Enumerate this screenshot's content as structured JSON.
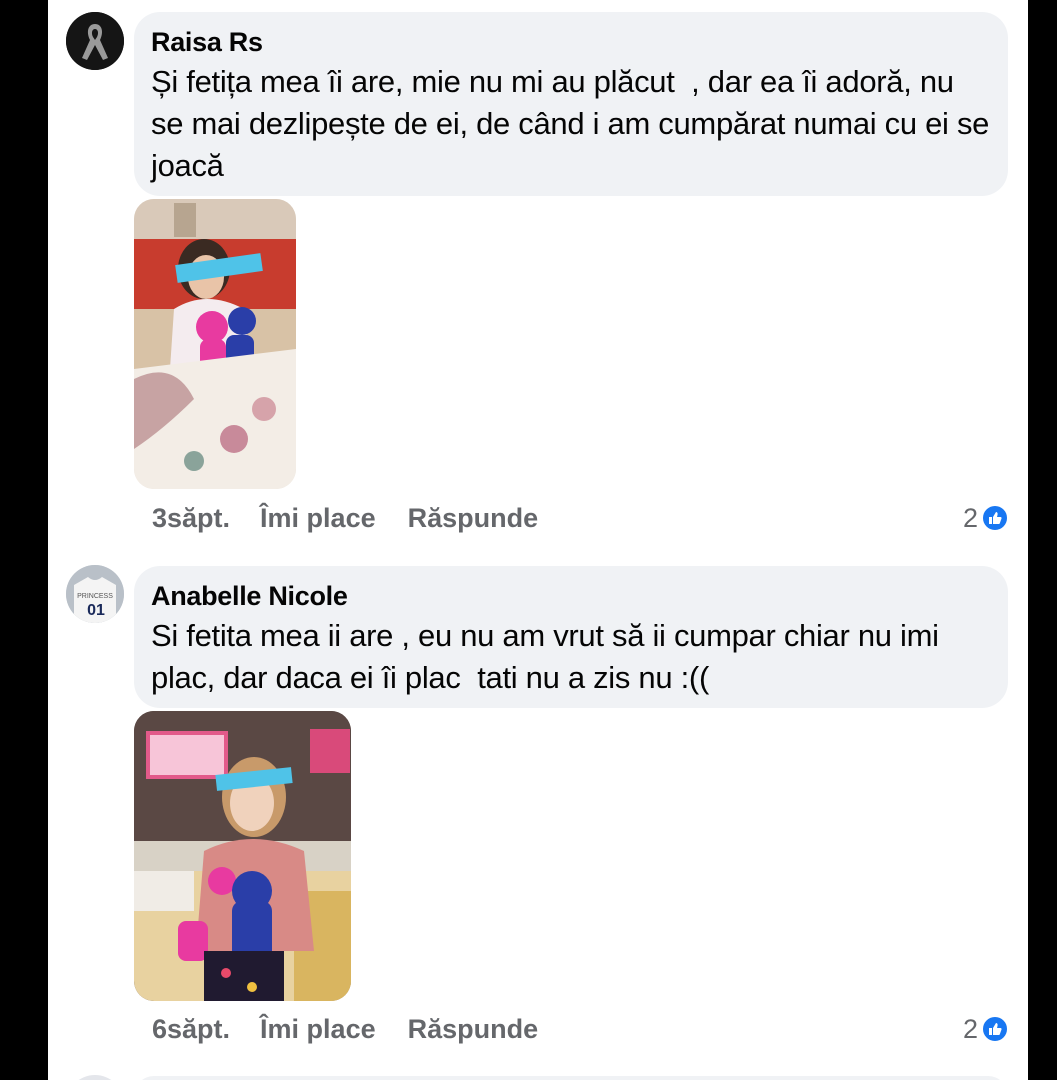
{
  "comments": [
    {
      "author": "Raisa Rs",
      "text": "Și fetița mea îi are, mie nu mi au plăcut  , dar ea îi adoră, nu se mai dezlipește de ei, de când i am cumpărat numai cu ei se joacă",
      "time": "3săpt.",
      "like_label": "Îmi place",
      "reply_label": "Răspunde",
      "reaction_count": "2"
    },
    {
      "author": "Anabelle Nicole",
      "text": "Si fetita mea ii are , eu nu am vrut să ii cumpar chiar nu imi plac, dar daca ei îi plac  tati nu a zis nu :((",
      "time": "6săpt.",
      "like_label": "Îmi place",
      "reply_label": "Răspunde",
      "reaction_count": "2"
    }
  ],
  "icons": {
    "reaction": "like-thumb-icon",
    "avatar_1": "black-ribbon-icon",
    "avatar_2": "shirt-photo-avatar"
  },
  "colors": {
    "bubble": "#f0f2f5",
    "meta_text": "#65676b",
    "like_blue": "#1877f2"
  }
}
